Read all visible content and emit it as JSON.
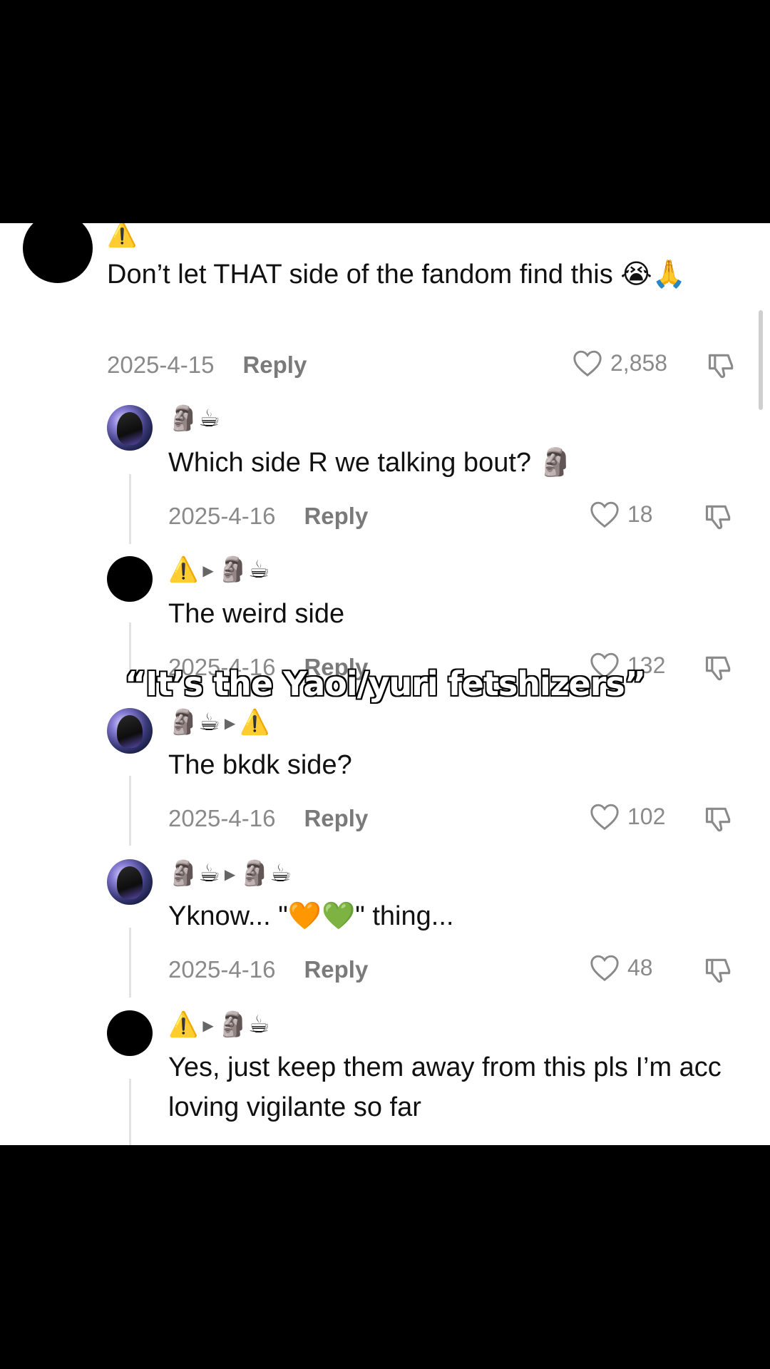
{
  "comments": [
    {
      "names": [
        "⚠️"
      ],
      "text": "Don’t let THAT side of the fandom find this 😭🙏",
      "date": "2025-4-15",
      "reply_label": "Reply",
      "likes": "2,858"
    },
    {
      "names": [
        "🗿☕"
      ],
      "text": "Which side R we talking bout? 🗿",
      "date": "2025-4-16",
      "reply_label": "Reply",
      "likes": "18"
    },
    {
      "names": [
        "⚠️",
        "🗿☕"
      ],
      "text": "The weird side",
      "date": "2025-4-16",
      "reply_label": "Reply",
      "likes": "132"
    },
    {
      "names": [
        "🗿☕",
        "⚠️"
      ],
      "text": "The bkdk side?",
      "date": "2025-4-16",
      "reply_label": "Reply",
      "likes": "102"
    },
    {
      "names": [
        "🗿☕",
        "🗿☕"
      ],
      "text": "Yknow... \"🧡💚\" thing...",
      "date": "2025-4-16",
      "reply_label": "Reply",
      "likes": "48"
    },
    {
      "names": [
        "⚠️",
        "🗿☕"
      ],
      "text": "Yes, just keep them away from this pls I’m acc loving vigilante so far"
    }
  ],
  "overlay_caption": "“It’s the Yaoi/yuri fetshizers”",
  "icons": {
    "like": "heart-outline-icon",
    "dislike": "thumbs-down-icon"
  }
}
